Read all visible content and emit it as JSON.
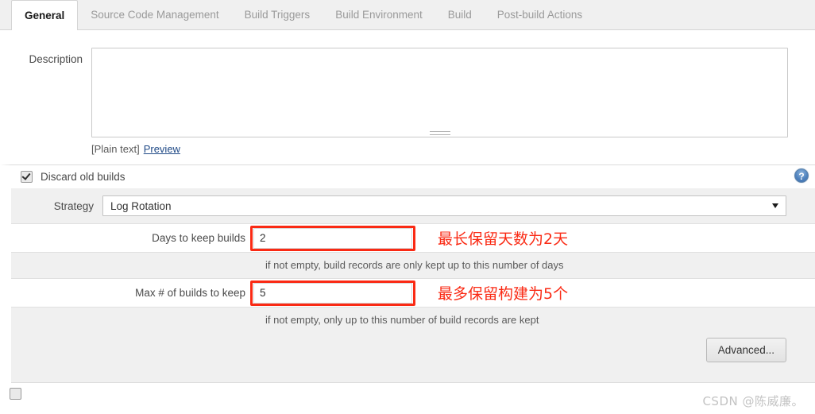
{
  "tabs": [
    {
      "label": "General",
      "active": true
    },
    {
      "label": "Source Code Management",
      "active": false
    },
    {
      "label": "Build Triggers",
      "active": false
    },
    {
      "label": "Build Environment",
      "active": false
    },
    {
      "label": "Build",
      "active": false
    },
    {
      "label": "Post-build Actions",
      "active": false
    }
  ],
  "description": {
    "label": "Description",
    "value": "",
    "placeholder": "",
    "markup_label": "[Plain text]",
    "preview_link": "Preview"
  },
  "discard": {
    "checkbox_label": "Discard old builds",
    "checked": true,
    "help_icon": "help-icon",
    "strategy": {
      "label": "Strategy",
      "selected": "Log Rotation",
      "options": [
        "Log Rotation"
      ]
    },
    "days_to_keep": {
      "label": "Days to keep builds",
      "value": "2",
      "help": "if not empty, build records are only kept up to this number of days",
      "annotation": "最长保留天数为2天"
    },
    "max_builds": {
      "label": "Max # of builds to keep",
      "value": "5",
      "help": "if not empty, only up to this number of build records are kept",
      "annotation": "最多保留构建为5个"
    },
    "advanced_button": "Advanced..."
  },
  "watermark": "CSDN @陈威廉。",
  "colors": {
    "annotation_red": "#fa2a14",
    "link_blue": "#204a87",
    "section_bg": "#f0f0f0",
    "help_icon_blue": "#4f82bd"
  }
}
